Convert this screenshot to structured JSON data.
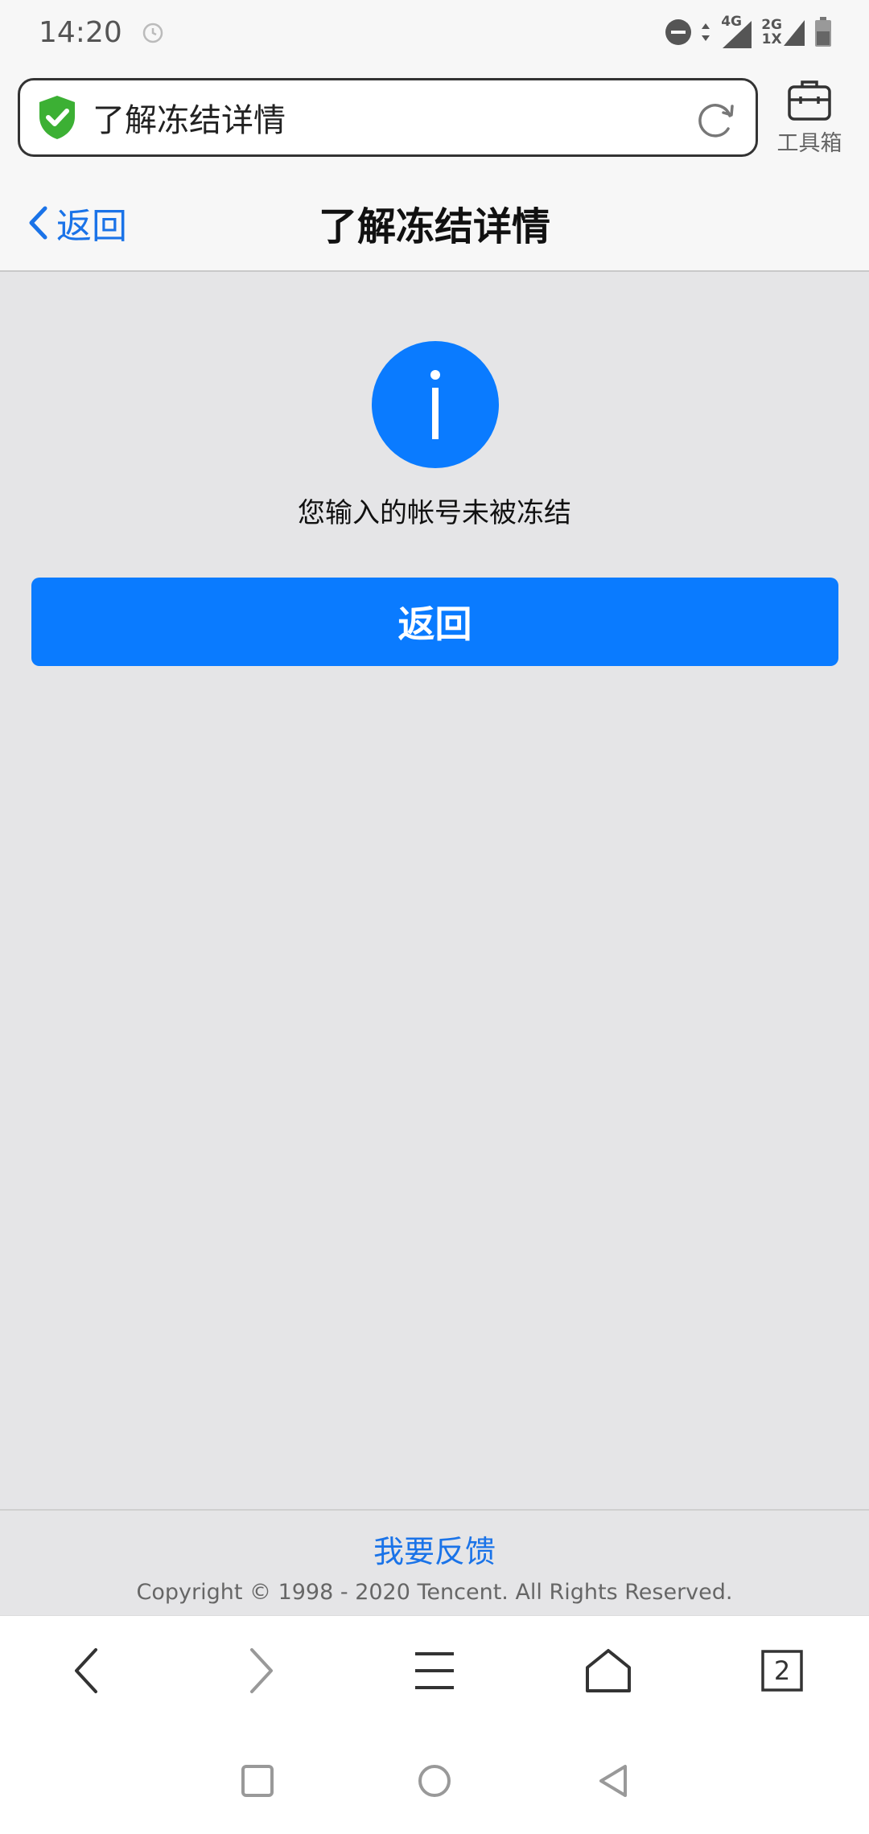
{
  "status_bar": {
    "time": "14:20",
    "network_primary": "4G",
    "network_secondary_top": "2G",
    "network_secondary_bottom": "1X"
  },
  "browser": {
    "url_title": "了解冻结详情",
    "toolbox_label": "工具箱",
    "tab_count": "2"
  },
  "nav": {
    "back_label": "返回",
    "title": "了解冻结详情"
  },
  "main": {
    "message": "您输入的帐号未被冻结",
    "button_label": "返回"
  },
  "footer": {
    "feedback_label": "我要反馈",
    "copyright": "Copyright © 1998 - 2020 Tencent. All Rights Reserved."
  },
  "colors": {
    "accent": "#0a7bff",
    "link": "#1a73e8",
    "background": "#e5e5e7",
    "shield": "#3cb034"
  },
  "icons": {
    "security": "shield-check-icon",
    "refresh": "refresh-icon",
    "toolbox": "toolbox-icon",
    "info": "info-icon"
  }
}
